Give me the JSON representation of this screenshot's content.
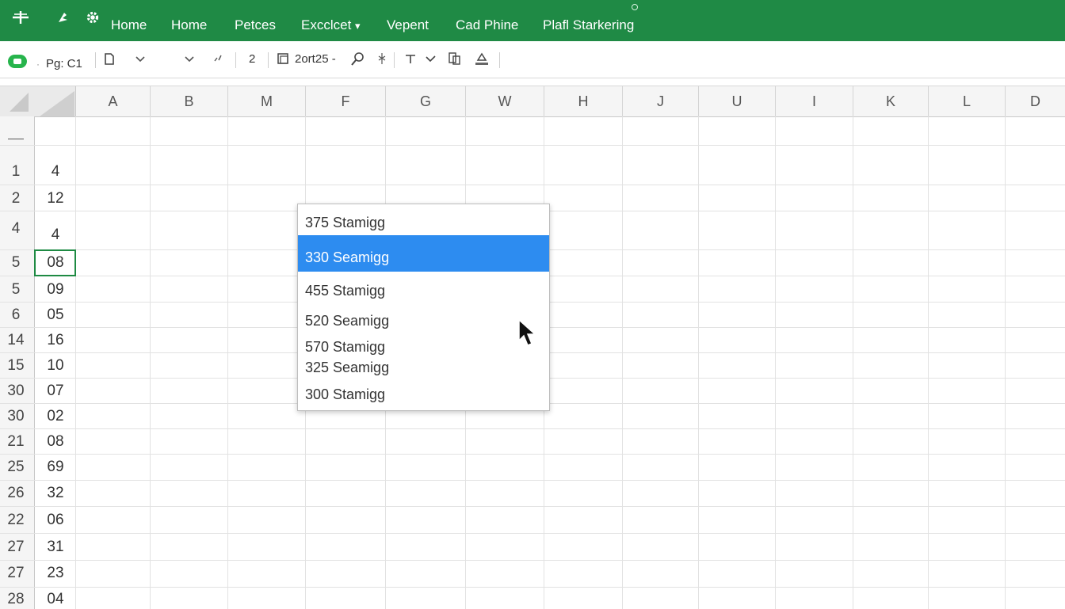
{
  "topbar": {
    "icons": [
      "grid-plus-icon",
      "pin-icon",
      "gear-icon"
    ],
    "menu": [
      "Home",
      "Home",
      "Petces",
      "Excclcet",
      "Vepent",
      "Cad Phine",
      "Plafl Starkering"
    ],
    "excel_chevron": "▾"
  },
  "toolbar": {
    "cell_ref": "Pg: C1",
    "num_field": "2",
    "font_size": "2ort25 -",
    "icons": [
      "chat-icon",
      "clipboard-icon",
      "chevron-down-icon",
      "dropdown-arrow-icon",
      "tick-icon",
      "format-icon",
      "search-icon",
      "brush-icon",
      "text-icon",
      "check-icon",
      "copy-icon",
      "fill-icon"
    ]
  },
  "columns": [
    "A",
    "B",
    "M",
    "F",
    "G",
    "W",
    "H",
    "J",
    "U",
    "I",
    "K",
    "L",
    "D"
  ],
  "rows": [
    {
      "num": "",
      "value": ""
    },
    {
      "num": "1",
      "value": "4"
    },
    {
      "num": "2",
      "value": "12"
    },
    {
      "num": "4",
      "value": "4"
    },
    {
      "num": "5",
      "value": "08"
    },
    {
      "num": "5",
      "value": "09"
    },
    {
      "num": "6",
      "value": "05"
    },
    {
      "num": "14",
      "value": "16"
    },
    {
      "num": "15",
      "value": "10"
    },
    {
      "num": "30",
      "value": "07"
    },
    {
      "num": "30",
      "value": "02"
    },
    {
      "num": "21",
      "value": "08"
    },
    {
      "num": "25",
      "value": "69"
    },
    {
      "num": "26",
      "value": "32"
    },
    {
      "num": "22",
      "value": "06"
    },
    {
      "num": "27",
      "value": "31"
    },
    {
      "num": "27",
      "value": "23"
    },
    {
      "num": "28",
      "value": "04"
    }
  ],
  "dropdown": {
    "items": [
      "375  Stamigg",
      "330  Seamigg",
      "455  Stamigg",
      "520  Seamigg",
      "570  Stamigg",
      "325  Seamigg",
      "300  Stamigg"
    ],
    "selected_index": 1
  },
  "colors": {
    "ribbon": "#1f8a45",
    "selection": "#2d8cf0",
    "active_cell_border": "#1e8a43"
  }
}
